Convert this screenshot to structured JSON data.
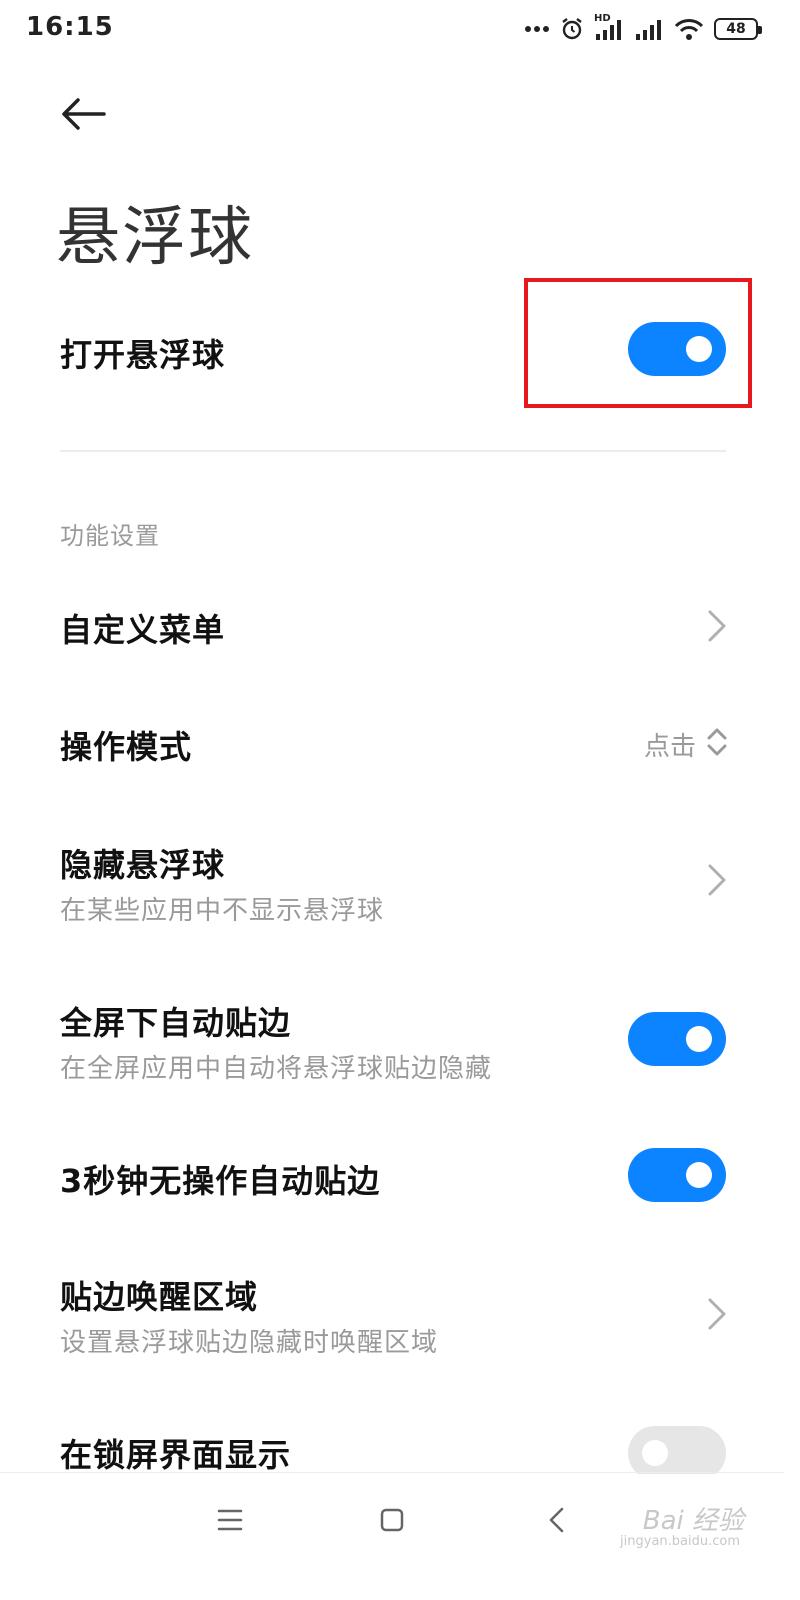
{
  "status_bar": {
    "time": "16:15",
    "network_label": "HD",
    "battery": "48",
    "icons": [
      "more-dots-icon",
      "alarm-icon",
      "signal-hd-icon",
      "signal-icon",
      "wifi-icon",
      "battery-icon"
    ]
  },
  "header": {
    "back_icon": "arrow-left-icon",
    "title": "悬浮球"
  },
  "main_toggle": {
    "label": "打开悬浮球",
    "on": true
  },
  "section": {
    "header": "功能设置"
  },
  "items": [
    {
      "label": "自定义菜单",
      "control": "chevron"
    },
    {
      "label": "操作模式",
      "value": "点击",
      "control": "updown"
    },
    {
      "label": "隐藏悬浮球",
      "subtitle": "在某些应用中不显示悬浮球",
      "control": "chevron"
    },
    {
      "label": "全屏下自动贴边",
      "subtitle": "在全屏应用中自动将悬浮球贴边隐藏",
      "control": "toggle",
      "on": true
    },
    {
      "label": "3秒钟无操作自动贴边",
      "control": "toggle",
      "on": true
    },
    {
      "label": "贴边唤醒区域",
      "subtitle": "设置悬浮球贴边隐藏时唤醒区域",
      "control": "chevron"
    },
    {
      "label": "在锁屏界面显示",
      "control": "toggle",
      "on": false
    }
  ],
  "colors": {
    "accent": "#0d84ff",
    "highlight": "#e8191d",
    "toggle_off": "#e6e6e6"
  },
  "navbar": {
    "icons": [
      "menu-icon",
      "home-icon",
      "back-icon"
    ]
  },
  "watermark": {
    "text": "Bai 经验",
    "sub": "jingyan.baidu.com"
  }
}
